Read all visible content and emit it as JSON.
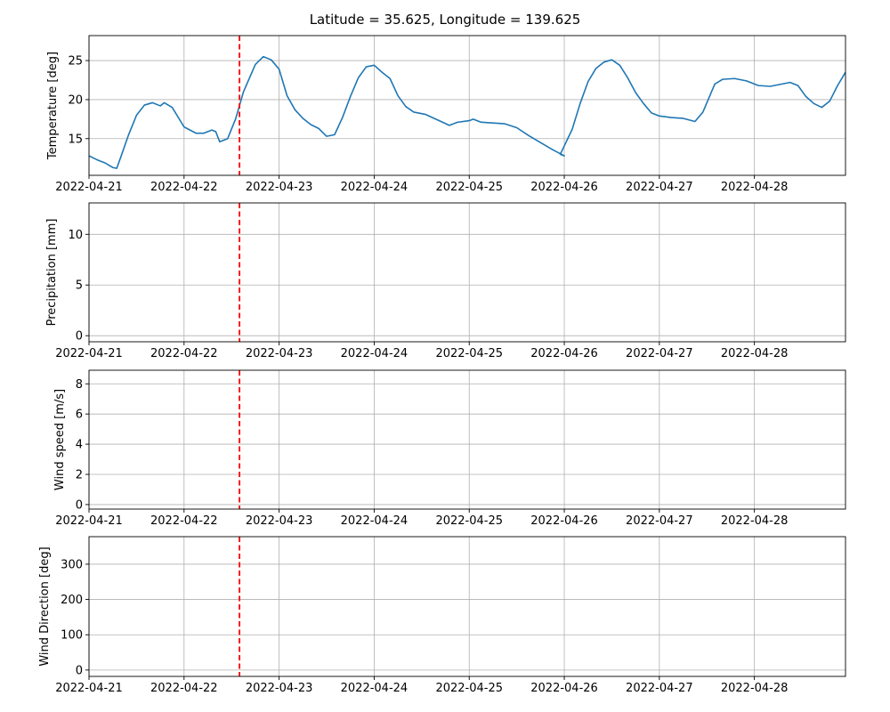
{
  "title": "Latitude = 35.625, Longitude = 139.625",
  "chart_data": {
    "x_start": "2022-04-21T00:00",
    "x_end": "2022-04-28T23:00",
    "x_tick_labels": [
      "2022-04-21",
      "2022-04-22",
      "2022-04-23",
      "2022-04-24",
      "2022-04-25",
      "2022-04-26",
      "2022-04-27",
      "2022-04-28"
    ],
    "marker_line": {
      "x": "2022-04-22T14:00",
      "color": "#ff0000",
      "style": "dashed"
    },
    "line_color": "#1f77b4",
    "grid": true,
    "panels": [
      {
        "type": "line",
        "ylabel": "Temperature [deg]",
        "ylim": [
          10.3,
          28.2
        ],
        "yticks": [
          15,
          20,
          25
        ],
        "points": [
          [
            "2022-04-21T00:00",
            12.8
          ],
          [
            "2022-04-21T02:00",
            12.3
          ],
          [
            "2022-04-21T04:00",
            11.9
          ],
          [
            "2022-04-21T06:00",
            11.3
          ],
          [
            "2022-04-21T07:00",
            11.2
          ],
          [
            "2022-04-21T08:00",
            12.6
          ],
          [
            "2022-04-21T10:00",
            15.5
          ],
          [
            "2022-04-21T12:00",
            18.0
          ],
          [
            "2022-04-21T14:00",
            19.3
          ],
          [
            "2022-04-21T16:00",
            19.6
          ],
          [
            "2022-04-21T18:00",
            19.2
          ],
          [
            "2022-04-21T19:00",
            19.6
          ],
          [
            "2022-04-21T21:00",
            19.0
          ],
          [
            "2022-04-22T00:00",
            16.5
          ],
          [
            "2022-04-22T03:00",
            15.7
          ],
          [
            "2022-04-22T05:00",
            15.7
          ],
          [
            "2022-04-22T07:00",
            16.1
          ],
          [
            "2022-04-22T08:00",
            15.9
          ],
          [
            "2022-04-22T09:00",
            14.6
          ],
          [
            "2022-04-22T11:00",
            15.0
          ],
          [
            "2022-04-22T13:00",
            17.5
          ],
          [
            "2022-04-22T15:00",
            21.0
          ],
          [
            "2022-04-22T18:00",
            24.5
          ],
          [
            "2022-04-22T20:00",
            25.5
          ],
          [
            "2022-04-22T22:00",
            25.1
          ],
          [
            "2022-04-23T00:00",
            23.9
          ],
          [
            "2022-04-23T02:00",
            20.5
          ],
          [
            "2022-04-23T04:00",
            18.7
          ],
          [
            "2022-04-23T06:00",
            17.6
          ],
          [
            "2022-04-23T08:00",
            16.8
          ],
          [
            "2022-04-23T10:00",
            16.3
          ],
          [
            "2022-04-23T12:00",
            15.3
          ],
          [
            "2022-04-23T14:00",
            15.5
          ],
          [
            "2022-04-23T16:00",
            17.7
          ],
          [
            "2022-04-23T18:00",
            20.4
          ],
          [
            "2022-04-23T20:00",
            22.8
          ],
          [
            "2022-04-23T22:00",
            24.2
          ],
          [
            "2022-04-24T00:00",
            24.4
          ],
          [
            "2022-04-24T02:00",
            23.5
          ],
          [
            "2022-04-24T04:00",
            22.7
          ],
          [
            "2022-04-24T06:00",
            20.5
          ],
          [
            "2022-04-24T08:00",
            19.1
          ],
          [
            "2022-04-24T10:00",
            18.4
          ],
          [
            "2022-04-24T13:00",
            18.1
          ],
          [
            "2022-04-24T16:00",
            17.4
          ],
          [
            "2022-04-24T19:00",
            16.7
          ],
          [
            "2022-04-24T21:00",
            17.1
          ],
          [
            "2022-04-25T00:00",
            17.3
          ],
          [
            "2022-04-25T01:00",
            17.5
          ],
          [
            "2022-04-25T03:00",
            17.1
          ],
          [
            "2022-04-25T06:00",
            17.0
          ],
          [
            "2022-04-25T09:00",
            16.9
          ],
          [
            "2022-04-25T12:00",
            16.4
          ],
          [
            "2022-04-25T15:00",
            15.4
          ],
          [
            "2022-04-25T18:00",
            14.5
          ],
          [
            "2022-04-25T21:00",
            13.6
          ],
          [
            "2022-04-26T00:00",
            12.8
          ],
          [
            "2022-04-25T23:00",
            13.0
          ],
          [
            "2022-04-26T02:00",
            16.2
          ],
          [
            "2022-04-26T04:00",
            19.5
          ],
          [
            "2022-04-26T06:00",
            22.3
          ],
          [
            "2022-04-26T08:00",
            24.0
          ],
          [
            "2022-04-26T10:00",
            24.8
          ],
          [
            "2022-04-26T12:00",
            25.1
          ],
          [
            "2022-04-26T14:00",
            24.4
          ],
          [
            "2022-04-26T16:00",
            22.8
          ],
          [
            "2022-04-26T18:00",
            20.9
          ],
          [
            "2022-04-26T20:00",
            19.5
          ],
          [
            "2022-04-26T22:00",
            18.3
          ],
          [
            "2022-04-27T00:00",
            17.9
          ],
          [
            "2022-04-27T03:00",
            17.7
          ],
          [
            "2022-04-27T06:00",
            17.6
          ],
          [
            "2022-04-27T09:00",
            17.2
          ],
          [
            "2022-04-27T11:00",
            18.4
          ],
          [
            "2022-04-27T14:00",
            22.0
          ],
          [
            "2022-04-27T16:00",
            22.6
          ],
          [
            "2022-04-27T19:00",
            22.7
          ],
          [
            "2022-04-27T22:00",
            22.4
          ],
          [
            "2022-04-28T01:00",
            21.8
          ],
          [
            "2022-04-28T04:00",
            21.7
          ],
          [
            "2022-04-28T07:00",
            22.0
          ],
          [
            "2022-04-28T09:00",
            22.2
          ],
          [
            "2022-04-28T11:00",
            21.8
          ],
          [
            "2022-04-28T13:00",
            20.4
          ],
          [
            "2022-04-28T15:00",
            19.5
          ],
          [
            "2022-04-28T17:00",
            19.0
          ],
          [
            "2022-04-28T19:00",
            19.8
          ],
          [
            "2022-04-28T21:00",
            21.8
          ],
          [
            "2022-04-28T23:00",
            23.5
          ]
        ]
      },
      {
        "type": "line",
        "ylabel": "Precipitation [mm]",
        "ylim": [
          -0.6,
          13.1
        ],
        "yticks": [
          0,
          5,
          10
        ],
        "points": []
      },
      {
        "type": "line",
        "ylabel": "Wind speed [m/s]",
        "ylim": [
          -0.3,
          8.9
        ],
        "yticks": [
          0,
          2,
          4,
          6,
          8
        ],
        "points": []
      },
      {
        "type": "line",
        "ylabel": "Wind Direction [deg]",
        "ylim": [
          -18,
          378
        ],
        "yticks": [
          0,
          100,
          200,
          300
        ],
        "points": []
      }
    ]
  }
}
